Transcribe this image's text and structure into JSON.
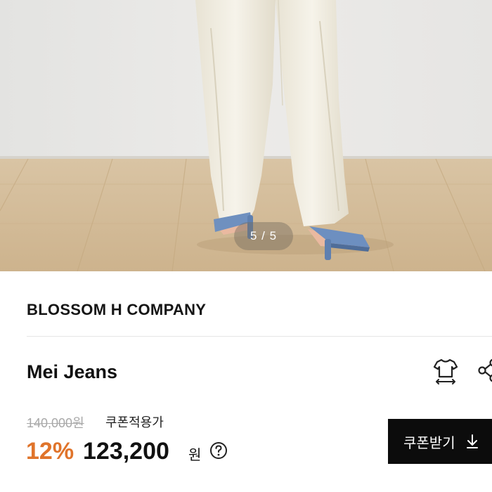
{
  "gallery": {
    "counter": "5 / 5"
  },
  "product": {
    "brand": "BLOSSOM H COMPANY",
    "title": "Mei Jeans"
  },
  "price": {
    "original": "140,000원",
    "coupon_note": "쿠폰적용가",
    "discount": "12%",
    "sale": "123,200",
    "currency": "원",
    "accent_color": "#e0742b"
  },
  "actions": {
    "coupon_button": "쿠폰받기",
    "size_icon": "tshirt-size-icon",
    "share_icon": "share-icon",
    "help_icon": "question-circle-icon",
    "download_icon": "download-arrow-icon"
  }
}
